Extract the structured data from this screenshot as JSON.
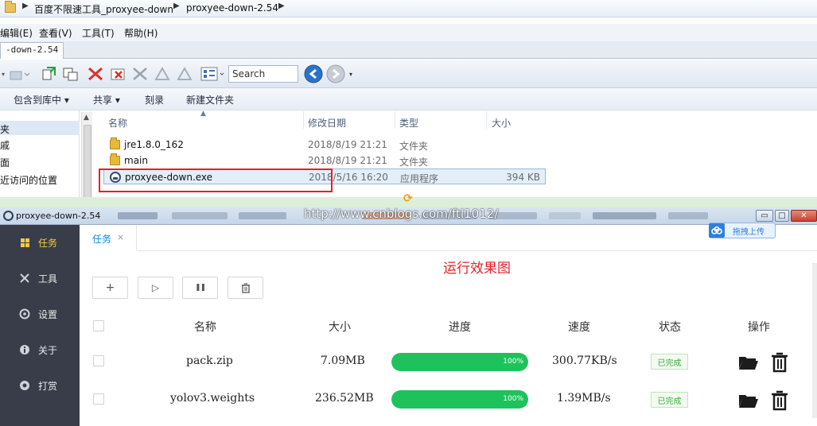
{
  "explorer": {
    "breadcrumb": [
      "百度不限速工具_proxyee-down",
      "proxyee-down-2.54"
    ],
    "menu": [
      "编辑(E)",
      "查看(V)",
      "工具(T)",
      "帮助(H)"
    ],
    "tab_label": "-down-2.54",
    "search_placeholder": "Search",
    "commands": [
      "包含到库中 ▾",
      "共享 ▾",
      "刻录",
      "新建文件夹"
    ],
    "nav_items": [
      "夹",
      "戚",
      "面",
      "近访问的位置"
    ],
    "columns": [
      "名称",
      "修改日期",
      "类型",
      "大小"
    ],
    "files": [
      {
        "name": "jre1.8.0_162",
        "date": "2018/8/19 21:21",
        "type": "文件夹",
        "size": ""
      },
      {
        "name": "main",
        "date": "2018/8/19 21:21",
        "type": "文件夹",
        "size": ""
      },
      {
        "name": "proxyee-down.exe",
        "date": "2018/5/16 16:20",
        "type": "应用程序",
        "size": "394 KB"
      }
    ]
  },
  "app": {
    "title": "proxyee-down-2.54",
    "watermark": "http://www.cnblogs.com/ftl1012/",
    "upload_chip": "拖拽上传",
    "window_controls": [
      "▭",
      "□",
      "✕"
    ],
    "sidebar": [
      {
        "label": "任务",
        "icon": "grid-icon",
        "active": true
      },
      {
        "label": "工具",
        "icon": "tools-icon",
        "active": false
      },
      {
        "label": "设置",
        "icon": "settings-icon",
        "active": false
      },
      {
        "label": "关于",
        "icon": "info-icon",
        "active": false
      },
      {
        "label": "打赏",
        "icon": "donate-icon",
        "active": false
      }
    ],
    "tab": {
      "label": "任务",
      "close": "×"
    },
    "caption": "运行效果图",
    "actions": [
      "+",
      "▷",
      "❚❚",
      "🗑"
    ],
    "table": {
      "headers": [
        "名称",
        "大小",
        "进度",
        "速度",
        "状态",
        "操作"
      ],
      "rows": [
        {
          "name": "pack.zip",
          "size": "7.09MB",
          "progress": 100,
          "progress_label": "100%",
          "speed": "300.77KB/s",
          "status": "已完成"
        },
        {
          "name": "yolov3.weights",
          "size": "236.52MB",
          "progress": 100,
          "progress_label": "100%",
          "speed": "1.39MB/s",
          "status": "已完成"
        }
      ]
    },
    "colors": {
      "sidebar": "#393d49",
      "active": "#f2c94c",
      "progress": "#1ec25b",
      "tab_accent": "#0f86e5",
      "caption": "#e0242a"
    }
  }
}
